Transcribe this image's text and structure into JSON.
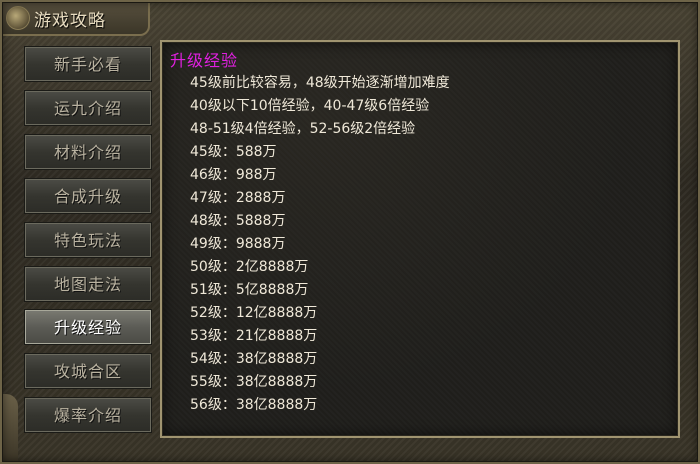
{
  "window": {
    "title": "游戏攻略"
  },
  "menu": {
    "items": [
      {
        "label": "新手必看",
        "active": false
      },
      {
        "label": "运九介绍",
        "active": false
      },
      {
        "label": "材料介绍",
        "active": false
      },
      {
        "label": "合成升级",
        "active": false
      },
      {
        "label": "特色玩法",
        "active": false
      },
      {
        "label": "地图走法",
        "active": false
      },
      {
        "label": "升级经验",
        "active": true
      },
      {
        "label": "攻城合区",
        "active": false
      },
      {
        "label": "爆率介绍",
        "active": false
      }
    ]
  },
  "content": {
    "title": "升级经验",
    "title_color": "#e020e0",
    "lines": [
      "45级前比较容易，48级开始逐渐增加难度",
      "40级以下10倍经验，40-47级6倍经验",
      "48-51级4倍经验，52-56级2倍经验",
      "45级：588万",
      "46级：988万",
      "47级：2888万",
      "48级：5888万",
      "49级：9888万",
      "50级：2亿8888万",
      "51级：5亿8888万",
      "52级：12亿8888万",
      "53级：21亿8888万",
      "54级：38亿8888万",
      "55级：38亿8888万",
      "56级：38亿8888万"
    ]
  }
}
